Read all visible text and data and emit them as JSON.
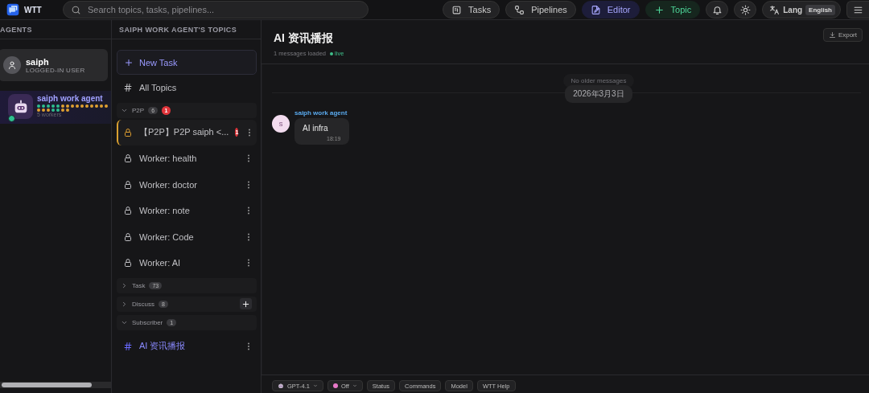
{
  "topbar": {
    "logo_text": "WTT",
    "search": {
      "placeholder": "Search topics, tasks, pipelines..."
    },
    "buttons": [
      {
        "kind": "tasks",
        "label": "Tasks"
      },
      {
        "kind": "pipelines",
        "label": "Pipelines"
      },
      {
        "kind": "editor",
        "label": "Editor"
      },
      {
        "kind": "topic",
        "label": "Topic"
      },
      {
        "kind": "bell"
      },
      {
        "kind": "theme"
      },
      {
        "kind": "lang",
        "label": "Lang",
        "value": "English"
      },
      {
        "kind": "menu"
      }
    ]
  },
  "agents": {
    "heading": "AGENTS",
    "user": {
      "name": "saiph",
      "role": "LOGGED-IN USER"
    },
    "items": [
      {
        "name": "saiph work agent",
        "online": true,
        "selected": true,
        "workers": "5 workers",
        "dots": [
          {
            "color": "#2ebf8f"
          },
          {
            "color": "#2ebf8f"
          },
          {
            "color": "#2ebf8f"
          },
          {
            "color": "#2ebf8f"
          },
          {
            "color": "#2ebf8f"
          },
          {
            "color": "#e0a030"
          },
          {
            "color": "#e0a030"
          },
          {
            "color": "#e0a030"
          },
          {
            "color": "#e0a030"
          },
          {
            "color": "#e0a030"
          },
          {
            "color": "#e0a030"
          },
          {
            "color": "#e0a030"
          },
          {
            "color": "#e0a030"
          },
          {
            "color": "#e0a030"
          },
          {
            "color": "#e0a030"
          },
          {
            "color": "#e0a030"
          },
          {
            "color": "#e0a030"
          },
          {
            "color": "#e0a030"
          },
          {
            "color": "#2ebf8f"
          },
          {
            "color": "#2ebf8f"
          },
          {
            "color": "#e0a030"
          },
          {
            "color": "#e0a030"
          }
        ]
      }
    ]
  },
  "topics": {
    "heading": "SAIPH WORK AGENT'S TOPICS",
    "new_task": "New Task",
    "all_topics": "All Topics",
    "groups": [
      {
        "label": "P2P",
        "count": "6",
        "alert": "1",
        "expanded": true,
        "addable": false,
        "items": [
          {
            "kind": "lock",
            "title": "【P2P】P2P saiph <...",
            "selected": true,
            "alert": "1"
          },
          {
            "kind": "lock",
            "title": "Worker: health",
            "selected": false
          },
          {
            "kind": "lock",
            "title": "Worker: doctor",
            "selected": false
          },
          {
            "kind": "lock",
            "title": "Worker: note",
            "selected": false
          },
          {
            "kind": "lock",
            "title": "Worker: Code",
            "selected": false
          },
          {
            "kind": "lock",
            "title": "Worker: AI",
            "selected": false
          }
        ]
      },
      {
        "label": "Task",
        "count": "73",
        "expanded": false,
        "addable": false
      },
      {
        "label": "Discuss",
        "count": "8",
        "expanded": false,
        "addable": true
      },
      {
        "label": "Subscriber",
        "count": "1",
        "expanded": true,
        "addable": false,
        "items": [
          {
            "kind": "hash",
            "title": "AI 资讯播报",
            "selected": false,
            "current": true
          }
        ]
      }
    ]
  },
  "chat": {
    "title": "AI 资讯播报",
    "subtitle": "1 messages loaded",
    "status": "live",
    "export": "Export",
    "no_older": "No older messages",
    "date": "2026年3月3日",
    "messages": [
      {
        "avatar": "S",
        "sender": "saiph work agent",
        "text": "AI infra",
        "time": "18:19"
      }
    ],
    "toolbar": [
      {
        "kind": "model",
        "label": "GPT-4.1"
      },
      {
        "kind": "toggle",
        "label": "Off"
      },
      {
        "kind": "plain",
        "label": "Status"
      },
      {
        "kind": "plain",
        "label": "Commands"
      },
      {
        "kind": "plain",
        "label": "Model"
      },
      {
        "kind": "plain",
        "label": "WTT Help"
      }
    ]
  }
}
